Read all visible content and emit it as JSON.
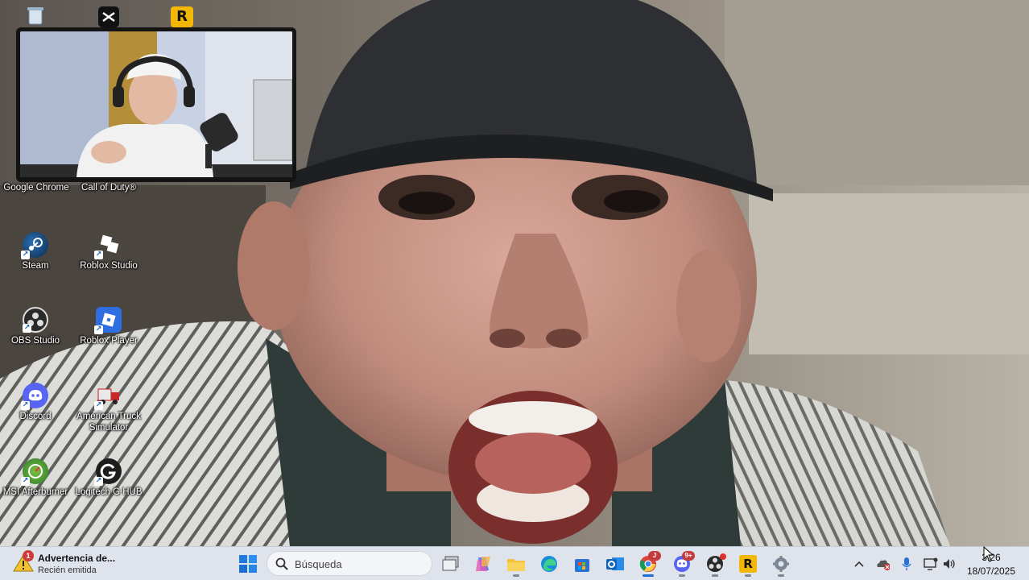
{
  "desktop": {
    "icons": [
      {
        "label": "Google Chrome",
        "icon": "chrome-icon"
      },
      {
        "label": "Call of Duty®",
        "icon": "call-of-duty-icon"
      },
      {
        "label": "Steam",
        "icon": "steam-icon"
      },
      {
        "label": "Roblox Studio",
        "icon": "roblox-studio-icon"
      },
      {
        "label": "OBS Studio",
        "icon": "obs-icon"
      },
      {
        "label": "Roblox Player",
        "icon": "roblox-player-icon"
      },
      {
        "label": "Discord",
        "icon": "discord-icon"
      },
      {
        "label": "American Truck Simulator",
        "icon": "truck-icon"
      },
      {
        "label": "MSI Afterburner",
        "icon": "msi-afterburner-icon"
      },
      {
        "label": "Logitech G HUB",
        "icon": "logitech-g-hub-icon"
      }
    ]
  },
  "notification": {
    "title": "Advertencia de...",
    "subtitle": "Recién emitida",
    "badge": "1",
    "icon": "warning-icon"
  },
  "taskbar": {
    "search_placeholder": "Búsqueda",
    "apps": [
      {
        "name": "start",
        "icon": "windows-start-icon"
      },
      {
        "name": "task-view",
        "icon": "task-view-icon"
      },
      {
        "name": "copilot",
        "icon": "copilot-icon"
      },
      {
        "name": "file-explorer",
        "icon": "folder-icon"
      },
      {
        "name": "edge",
        "icon": "edge-icon"
      },
      {
        "name": "store",
        "icon": "store-icon"
      },
      {
        "name": "outlook",
        "icon": "outlook-icon"
      },
      {
        "name": "chrome",
        "icon": "chrome-icon",
        "badge": "J"
      },
      {
        "name": "discord",
        "icon": "discord-icon",
        "badge": "9+"
      },
      {
        "name": "obs",
        "icon": "obs-icon"
      },
      {
        "name": "rockstar",
        "icon": "rockstar-icon"
      },
      {
        "name": "settings",
        "icon": "settings-icon"
      }
    ]
  },
  "tray": {
    "icons": [
      "chevron-up-icon",
      "onedrive-error-icon",
      "microphone-icon",
      "network-icon",
      "volume-icon"
    ],
    "time": "3:26",
    "date": "18/07/2025"
  },
  "colors": {
    "taskbar_bg": "#dfe4ec",
    "accent": "#1a6fd1"
  }
}
